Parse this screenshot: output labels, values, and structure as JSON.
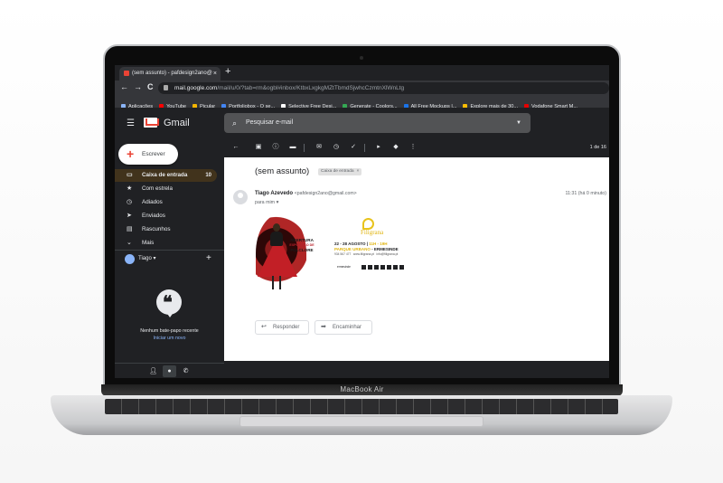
{
  "browser": {
    "tab_title": "(sem assunto) - pafdesign2ano@",
    "tab_close": "×",
    "new_tab": "+",
    "back": "←",
    "forward": "→",
    "reload": "C",
    "url_host": "mail.google.com",
    "url_path": "/mail/u/0/?tab=rm&ogbl#inbox/KtbxLxgkgMZtTbmdSjwhcCzmtnXlWnLtg",
    "bookmarks": [
      {
        "label": "Aplicações",
        "color": "#8ab4f8"
      },
      {
        "label": "YouTube",
        "color": "#ff0000"
      },
      {
        "label": "Picular",
        "color": "#f4b400"
      },
      {
        "label": "Portfoliobox - O se...",
        "color": "#4285f4"
      },
      {
        "label": "Selective Free Desi...",
        "color": "#ffffff"
      },
      {
        "label": "Generate - Coolors...",
        "color": "#34a853"
      },
      {
        "label": "All Free Mockups |...",
        "color": "#1a73e8"
      },
      {
        "label": "Explore mais de 30...",
        "color": "#fbbc04"
      },
      {
        "label": "Vodafone Smart M...",
        "color": "#e60000"
      }
    ]
  },
  "gmail": {
    "app_name": "Gmail",
    "search_placeholder": "Pesquisar e-mail",
    "compose_label": "Escrever",
    "nav": [
      {
        "label": "Caixa de entrada",
        "count": "10",
        "icon": "inbox-icon",
        "glyph": "▭"
      },
      {
        "label": "Com estrela",
        "count": "",
        "icon": "star-icon",
        "glyph": "★"
      },
      {
        "label": "Adiados",
        "count": "",
        "icon": "clock-icon",
        "glyph": "◷"
      },
      {
        "label": "Enviados",
        "count": "",
        "icon": "send-icon",
        "glyph": "➤"
      },
      {
        "label": "Rascunhos",
        "count": "",
        "icon": "draft-icon",
        "glyph": "▤"
      },
      {
        "label": "Mais",
        "count": "",
        "icon": "chevron-down-icon",
        "glyph": "⌄"
      }
    ],
    "hangouts_user": "Tiago",
    "hangouts_caret": "▾",
    "hangouts_add": "+",
    "no_chats": "Nenhum bate-papo recente",
    "start_new": "Iniciar um novo",
    "pager": "1 de 16"
  },
  "message": {
    "subject": "(sem assunto)",
    "label_chip": "Caixa de entrada",
    "label_chip_close": "×",
    "sender_name": "Tiago Azevedo",
    "sender_email": "<pafdesign2ano@gmail.com>",
    "to_me": "para mim",
    "to_me_caret": "▾",
    "time": "11:31 (há 0 minuto)",
    "reply_label": "Responder",
    "forward_label": "Encaminhar"
  },
  "poster": {
    "abertura": "ABERTURA",
    "exposicao": "EXPOSIÇÃO DE",
    "folclore": "FOLCLORE",
    "filigrana": "Filigrana",
    "dates_main": "22 - 28 AGOSTO |",
    "dates_hl": "11H - 19H",
    "park": "PARQUE URBANO",
    "ermesinde": " - ERMESINDE",
    "phone": "934 567 477",
    "web": "www.filigrana.pt",
    "mail": "info@filigrana.pt",
    "sponsor_left": "ermesinde"
  },
  "laptop": {
    "model": "MacBook Air"
  }
}
